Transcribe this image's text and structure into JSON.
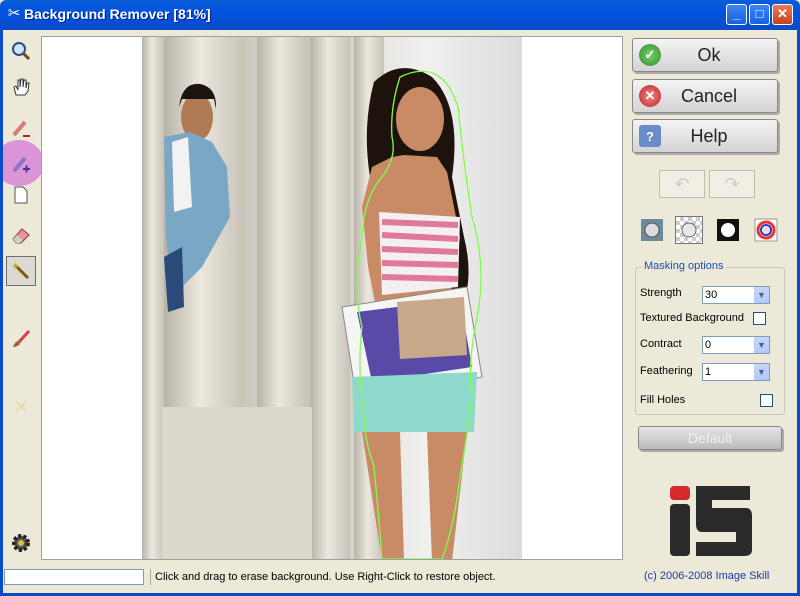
{
  "window": {
    "title": "Background Remover [81%]",
    "minimize": "_",
    "maximize": "□",
    "close": "✕"
  },
  "toolbar": {
    "tools": [
      {
        "name": "zoom",
        "icon": "magnifier-icon",
        "glyph": "🔍"
      },
      {
        "name": "pan",
        "icon": "hand-icon",
        "glyph": "✋"
      },
      {
        "name": "pencil-remove",
        "icon": "pencil-minus-icon",
        "glyph": "✏"
      },
      {
        "name": "pencil-add",
        "icon": "pencil-plus-icon",
        "glyph": "✏"
      },
      {
        "name": "page",
        "icon": "page-icon",
        "glyph": "▯"
      },
      {
        "name": "eraser",
        "icon": "eraser-icon",
        "glyph": "▰"
      },
      {
        "name": "magic-wand",
        "icon": "magic-wand-icon",
        "glyph": "✳"
      },
      {
        "name": "brush",
        "icon": "brush-icon",
        "glyph": "🖌"
      },
      {
        "name": "clear",
        "icon": "x-icon",
        "glyph": "✕"
      },
      {
        "name": "settings",
        "icon": "gear-icon",
        "glyph": "⚙"
      }
    ]
  },
  "buttons": {
    "ok": "Ok",
    "cancel": "Cancel",
    "help": "Help",
    "undo": "↶",
    "redo": "↷",
    "default": "Default"
  },
  "masking": {
    "title": "Masking options",
    "strength_label": "Strength",
    "strength_value": "30",
    "textured_label": "Textured Background",
    "textured_checked": false,
    "contract_label": "Contract",
    "contract_value": "0",
    "feathering_label": "Feathering",
    "feathering_value": "1",
    "fillholes_label": "Fill Holes",
    "fillholes_checked": false
  },
  "view_modes": [
    "original-view-icon",
    "transparent-view-icon",
    "mask-view-icon",
    "color-view-icon"
  ],
  "copyright": "(c) 2006-2008 Image Skill",
  "status": {
    "message": "Click and drag to erase background. Use Right-Click to restore object."
  },
  "colors": {
    "titlebar": "#0153e0",
    "accent_link": "#1d3aa8",
    "selection_outline": "#7cff4a"
  }
}
